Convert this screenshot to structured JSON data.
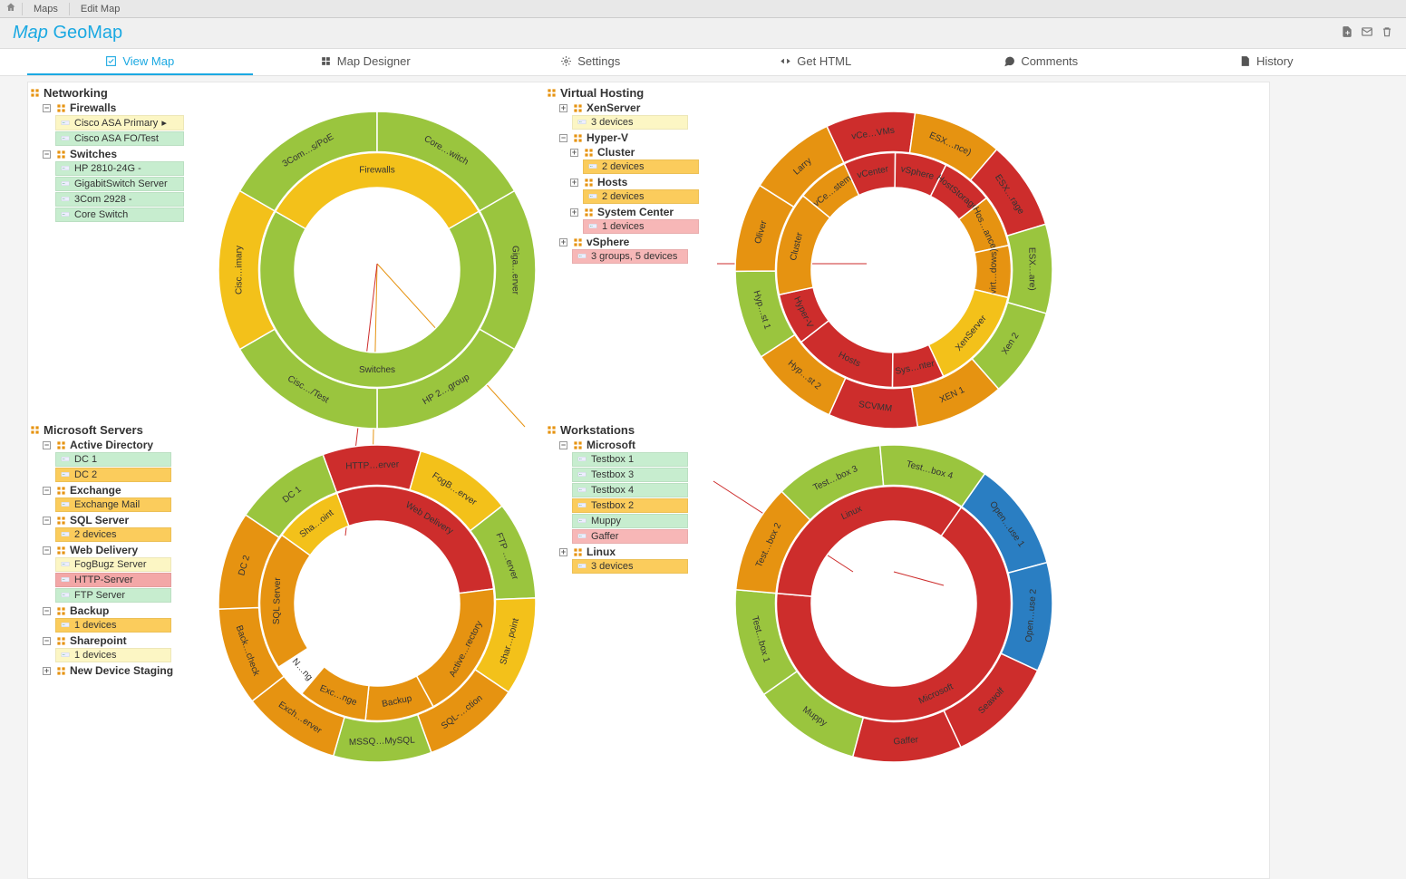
{
  "breadcrumb": {
    "maps": "Maps",
    "edit": "Edit Map"
  },
  "title": {
    "prefix": "Map",
    "name": "GeoMap"
  },
  "tabs": {
    "view": "View Map",
    "designer": "Map Designer",
    "settings": "Settings",
    "gethtml": "Get HTML",
    "comments": "Comments",
    "history": "History"
  },
  "colors": {
    "up": "#9ac53e",
    "warn": "#f3c11a",
    "warn2": "#e69311",
    "down": "#cd2d2c",
    "blue": "#2a7ec2"
  },
  "quad1": {
    "title": "Networking",
    "groups": [
      {
        "name": "Firewalls",
        "items": [
          {
            "label": "Cisco ASA Primary",
            "status": "c-yellow",
            "flag": true
          },
          {
            "label": "Cisco ASA FO/Test",
            "status": "c-green"
          }
        ]
      },
      {
        "name": "Switches",
        "items": [
          {
            "label": "HP 2810-24G -",
            "status": "c-green",
            "icon": "hp"
          },
          {
            "label": "GigabitSwitch Server",
            "status": "c-green"
          },
          {
            "label": "3Com 2928 -",
            "status": "c-green"
          },
          {
            "label": "Core Switch",
            "status": "c-green"
          }
        ]
      }
    ]
  },
  "quad2": {
    "title": "Virtual Hosting",
    "groups": [
      {
        "name": "XenServer",
        "summary": "3 devices",
        "summary_status": "c-yellow"
      },
      {
        "name": "Hyper-V",
        "subgroups": [
          {
            "name": "Cluster",
            "summary": "2 devices",
            "summary_status": "c-orange"
          },
          {
            "name": "Hosts",
            "summary": "2 devices",
            "summary_status": "c-orange"
          },
          {
            "name": "System Center",
            "summary": "1 devices",
            "summary_status": "c-ored"
          }
        ]
      },
      {
        "name": "vSphere",
        "summary": "3 groups, 5 devices",
        "summary_status": "c-ored"
      }
    ]
  },
  "quad3": {
    "title": "Microsoft Servers",
    "groups": [
      {
        "name": "Active Directory",
        "items": [
          {
            "label": "DC 1",
            "status": "c-green"
          },
          {
            "label": "DC 2",
            "status": "c-orange"
          }
        ]
      },
      {
        "name": "Exchange",
        "items": [
          {
            "label": "Exchange Mail",
            "status": "c-orange"
          }
        ]
      },
      {
        "name": "SQL Server",
        "summary": "2 devices",
        "summary_status": "c-orange"
      },
      {
        "name": "Web Delivery",
        "items": [
          {
            "label": "FogBugz Server",
            "status": "c-yellow"
          },
          {
            "label": "HTTP-Server",
            "status": "c-red"
          },
          {
            "label": "FTP Server",
            "status": "c-green"
          }
        ]
      },
      {
        "name": "Backup",
        "summary": "1 devices",
        "summary_status": "c-orange"
      },
      {
        "name": "Sharepoint",
        "summary": "1 devices",
        "summary_status": "c-yellow"
      },
      {
        "name": "New Device Staging"
      }
    ]
  },
  "quad4": {
    "title": "Workstations",
    "groups": [
      {
        "name": "Microsoft",
        "items": [
          {
            "label": "Testbox 1",
            "status": "c-green"
          },
          {
            "label": "Testbox 3",
            "status": "c-green"
          },
          {
            "label": "Testbox 4",
            "status": "c-green"
          },
          {
            "label": "Testbox 2",
            "status": "c-orange"
          },
          {
            "label": "Muppy",
            "status": "c-green"
          },
          {
            "label": "Gaffer",
            "status": "c-ored"
          }
        ]
      },
      {
        "name": "Linux",
        "summary": "3 devices",
        "summary_status": "c-orange"
      }
    ]
  },
  "chart_data": [
    {
      "id": "c1",
      "type": "sunburst",
      "title": "Networking",
      "inner": [
        {
          "label": "Switches",
          "value": 4,
          "color": "up"
        },
        {
          "label": "Firewalls",
          "value": 2,
          "color": "warn"
        }
      ],
      "outer": [
        {
          "label": "Giga…erver",
          "value": 1,
          "color": "up",
          "parent": "Switches"
        },
        {
          "label": "HP 2…group",
          "value": 1,
          "color": "up",
          "parent": "Switches"
        },
        {
          "label": "Cisc…/Test",
          "value": 1,
          "color": "up",
          "parent": "Firewalls"
        },
        {
          "label": "Cisc…imary",
          "value": 1,
          "color": "warn",
          "parent": "Firewalls"
        },
        {
          "label": "3Com…s/PoE",
          "value": 1,
          "color": "up",
          "parent": "Switches"
        },
        {
          "label": "Core…witch",
          "value": 1,
          "color": "up",
          "parent": "Switches"
        }
      ]
    },
    {
      "id": "c2",
      "type": "sunburst",
      "title": "Virtual Hosting",
      "inner": [
        {
          "label": "vCenter",
          "value": 1,
          "color": "down"
        },
        {
          "label": "vSphere",
          "value": 1,
          "color": "down"
        },
        {
          "label": "HostStorage",
          "value": 1,
          "color": "down"
        },
        {
          "label": "Hos…ance",
          "value": 1,
          "color": "warn2"
        },
        {
          "label": "virt…dows)",
          "value": 1,
          "color": "warn2"
        },
        {
          "label": "XenServer",
          "value": 2,
          "color": "warn"
        },
        {
          "label": "Sys…nter",
          "value": 1,
          "color": "down"
        },
        {
          "label": "Hosts",
          "value": 2,
          "color": "down"
        },
        {
          "label": "Hyper-V",
          "value": 1,
          "color": "down"
        },
        {
          "label": "Cluster",
          "value": 2,
          "color": "warn2"
        },
        {
          "label": "vCe…stem",
          "value": 1,
          "color": "warn2"
        }
      ],
      "outer": [
        {
          "label": "vCe…VMs",
          "value": 1,
          "color": "down"
        },
        {
          "label": "ESX…nce)",
          "value": 1,
          "color": "warn2"
        },
        {
          "label": "ESX…rage",
          "value": 1,
          "color": "down"
        },
        {
          "label": "ESX…are)",
          "value": 1,
          "color": "up"
        },
        {
          "label": "Xen 2",
          "value": 1,
          "color": "up"
        },
        {
          "label": "XEN 1",
          "value": 1,
          "color": "warn2"
        },
        {
          "label": "SCVMM",
          "value": 1,
          "color": "down"
        },
        {
          "label": "Hyp…st 2",
          "value": 1,
          "color": "warn2"
        },
        {
          "label": "Hyp…st 1",
          "value": 1,
          "color": "up"
        },
        {
          "label": "Oliver",
          "value": 1,
          "color": "warn2"
        },
        {
          "label": "Larry",
          "value": 1,
          "color": "warn2"
        }
      ]
    },
    {
      "id": "c3",
      "type": "sunburst",
      "title": "Microsoft Servers",
      "inner": [
        {
          "label": "Web Delivery",
          "value": 3,
          "color": "down"
        },
        {
          "label": "Active…rectory",
          "value": 2,
          "color": "warn2"
        },
        {
          "label": "Backup",
          "value": 1,
          "color": "warn2"
        },
        {
          "label": "Exc…nge",
          "value": 1,
          "color": "warn2"
        },
        {
          "label": "N…ng",
          "value": 0.5,
          "color": "white"
        },
        {
          "label": "SQL Server",
          "value": 2,
          "color": "warn2"
        },
        {
          "label": "Sha…oint",
          "value": 1,
          "color": "warn"
        }
      ],
      "outer": [
        {
          "label": "HTTP…erver",
          "value": 1,
          "color": "down"
        },
        {
          "label": "FogB…erver",
          "value": 1,
          "color": "warn"
        },
        {
          "label": "FTP …erver",
          "value": 1,
          "color": "up"
        },
        {
          "label": "Shar…point",
          "value": 1,
          "color": "warn"
        },
        {
          "label": "SQL-…ction",
          "value": 1,
          "color": "warn2"
        },
        {
          "label": "MSSQ…MySQL",
          "value": 1,
          "color": "up"
        },
        {
          "label": "Exch…erver",
          "value": 1,
          "color": "warn2"
        },
        {
          "label": "Back…check",
          "value": 1,
          "color": "warn2"
        },
        {
          "label": "DC 2",
          "value": 1,
          "color": "warn2"
        },
        {
          "label": "DC 1",
          "value": 1,
          "color": "up"
        }
      ]
    },
    {
      "id": "c4",
      "type": "sunburst",
      "title": "Workstations",
      "inner": [
        {
          "label": "Microsoft",
          "value": 6,
          "color": "down"
        },
        {
          "label": "Linux",
          "value": 3,
          "color": "down"
        }
      ],
      "outer": [
        {
          "label": "Open…use 1",
          "value": 1,
          "color": "blue"
        },
        {
          "label": "Open…use 2",
          "value": 1,
          "color": "blue"
        },
        {
          "label": "Seawolf",
          "value": 1,
          "color": "down"
        },
        {
          "label": "Gaffer",
          "value": 1,
          "color": "down"
        },
        {
          "label": "Muppy",
          "value": 1,
          "color": "up"
        },
        {
          "label": "Test…box 1",
          "value": 1,
          "color": "up"
        },
        {
          "label": "Test…box 2",
          "value": 1,
          "color": "warn2"
        },
        {
          "label": "Test…box 3",
          "value": 1,
          "color": "up"
        },
        {
          "label": "Test…box 4",
          "value": 1,
          "color": "up"
        }
      ]
    }
  ]
}
